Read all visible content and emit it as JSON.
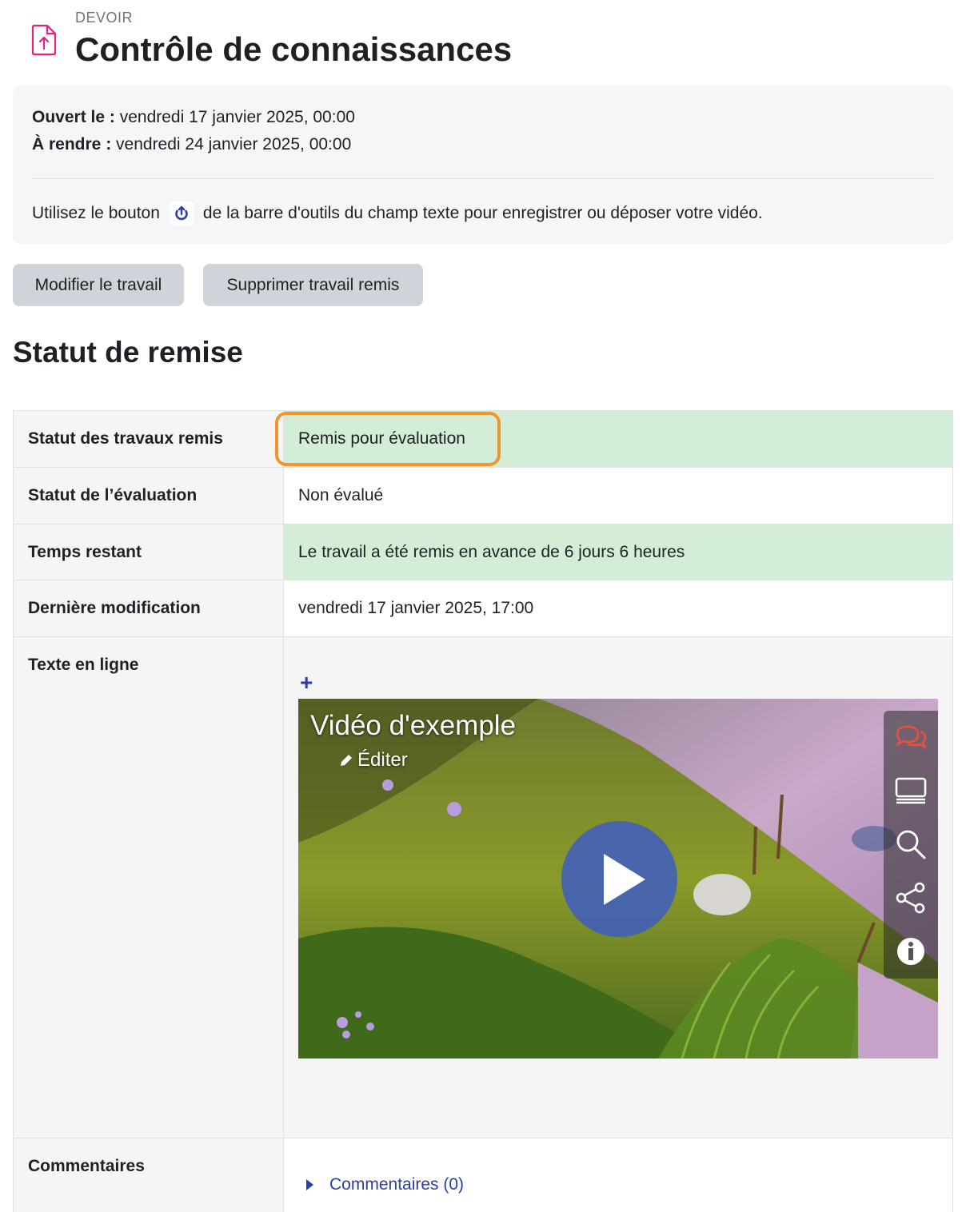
{
  "header": {
    "kicker": "DEVOIR",
    "title": "Contrôle de connaissances",
    "icon": "file-upload-icon",
    "icon_color": "#e2237d"
  },
  "dates": {
    "opened_label": "Ouvert le :",
    "opened_value": "vendredi 17 janvier 2025, 00:00",
    "due_label": "À rendre :",
    "due_value": "vendredi 24 janvier 2025, 00:00"
  },
  "instructions": {
    "before": "Utilisez le bouton",
    "after": "de la barre d'outils du champ texte pour enregistrer ou déposer votre vidéo.",
    "icon": "record-upload-icon"
  },
  "buttons": {
    "edit": "Modifier le travail",
    "delete": "Supprimer travail remis"
  },
  "section_title": "Statut de remise",
  "status_table": {
    "submission_status_label": "Statut des travaux remis",
    "submission_status_value": "Remis pour évaluation",
    "grading_status_label": "Statut de l’évaluation",
    "grading_status_value": "Non évalué",
    "time_remaining_label": "Temps restant",
    "time_remaining_value": "Le travail a été remis en avance de 6 jours 6 heures",
    "last_modified_label": "Dernière modification",
    "last_modified_value": "vendredi 17 janvier 2025, 17:00",
    "online_text_label": "Texte en ligne",
    "comments_label": "Commentaires",
    "comments_link": "Commentaires (0)"
  },
  "video": {
    "title": "Vidéo d'exemple",
    "edit_label": "Éditer",
    "sidebar_icons": [
      "comments-icon",
      "screen-icon",
      "search-icon",
      "share-icon",
      "info-icon"
    ]
  },
  "colors": {
    "highlight": "#f0962f",
    "success_bg": "#d4edd6",
    "link": "#2b3ea3"
  }
}
